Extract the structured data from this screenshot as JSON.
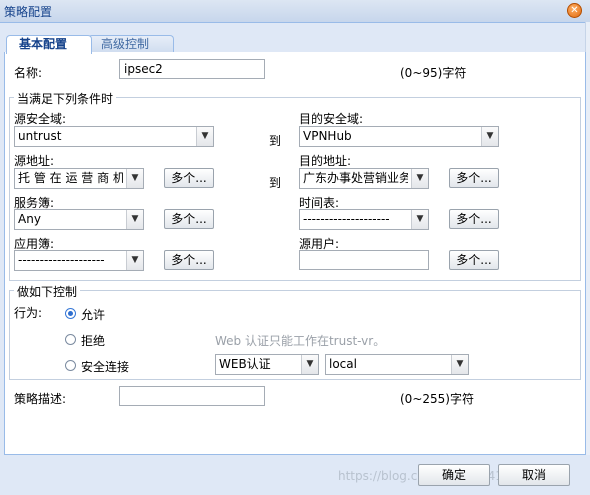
{
  "window": {
    "title": "策略配置"
  },
  "tabs": [
    {
      "label": "基本配置"
    },
    {
      "label": "高级控制"
    }
  ],
  "name": {
    "label": "名称:",
    "value": "ipsec2",
    "hint": "(0~95)字符"
  },
  "conditions": {
    "legend": "当满足下列条件时",
    "src_zone": {
      "label": "源安全域:",
      "value": "untrust"
    },
    "to1": "到",
    "dst_zone": {
      "label": "目的安全域:",
      "value": "VPNHub"
    },
    "src_addr": {
      "label": "源地址:",
      "value": "托 管 在 运 营 商 机"
    },
    "multi": "多个...",
    "to2": "到",
    "dst_addr": {
      "label": "目的地址:",
      "value": "广东办事处营销业务"
    },
    "service": {
      "label": "服务簿:",
      "value": "Any"
    },
    "schedule": {
      "label": "时间表:",
      "value": "--------------------"
    },
    "app": {
      "label": "应用簿:",
      "value": "--------------------"
    },
    "src_user": {
      "label": "源用户:",
      "value": ""
    }
  },
  "control": {
    "legend": "做如下控制",
    "action_label": "行为:",
    "options": [
      {
        "label": "允许",
        "selected": true
      },
      {
        "label": "拒绝",
        "selected": false
      },
      {
        "label": "安全连接",
        "selected": false
      }
    ],
    "web_note": "Web 认证只能工作在trust-vr。",
    "auth_type": "WEB认证",
    "auth_server": "local"
  },
  "description": {
    "label": "策略描述:",
    "value": "",
    "hint": "(0~255)字符"
  },
  "footer": {
    "ok": "确定",
    "cancel": "取消",
    "watermark": "https://blog.csdn.net/qq_41926704"
  },
  "colors": {
    "accent": "#15428b",
    "border": "#99bbe8",
    "radio": "#2f6fd0"
  }
}
